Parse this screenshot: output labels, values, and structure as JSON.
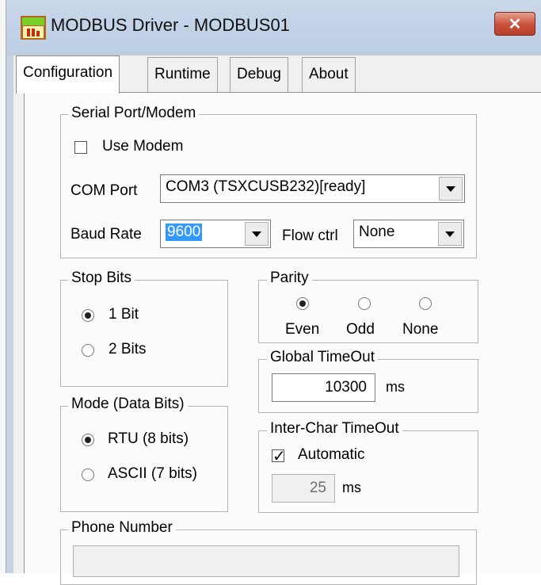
{
  "window": {
    "title": "MODBUS Driver - MODBUS01",
    "close_label": "✕"
  },
  "tabs": [
    {
      "label": "Configuration"
    },
    {
      "label": "Runtime"
    },
    {
      "label": "Debug"
    },
    {
      "label": "About"
    }
  ],
  "serial": {
    "legend": "Serial Port/Modem",
    "use_modem_label": "Use Modem",
    "use_modem_checked": false,
    "com_port_label": "COM Port",
    "com_port_value": "COM3 (TSXCUSB232)[ready]",
    "baud_label": "Baud Rate",
    "baud_value": "9600",
    "flow_label": "Flow ctrl",
    "flow_value": "None"
  },
  "stop_bits": {
    "legend": "Stop Bits",
    "options": [
      {
        "label": "1 Bit",
        "selected": true
      },
      {
        "label": "2 Bits",
        "selected": false
      }
    ]
  },
  "parity": {
    "legend": "Parity",
    "options": [
      {
        "label": "Even",
        "selected": true
      },
      {
        "label": "Odd",
        "selected": false
      },
      {
        "label": "None",
        "selected": false
      }
    ]
  },
  "global_timeout": {
    "legend": "Global TimeOut",
    "value": "10300",
    "unit": "ms"
  },
  "mode": {
    "legend": "Mode (Data Bits)",
    "options": [
      {
        "label": "RTU (8 bits)",
        "selected": true
      },
      {
        "label": "ASCII (7 bits)",
        "selected": false
      }
    ]
  },
  "inter_char": {
    "legend": "Inter-Char TimeOut",
    "automatic_label": "Automatic",
    "automatic_checked": true,
    "value": "25",
    "unit": "ms"
  },
  "phone": {
    "legend": "Phone Number",
    "value": ""
  }
}
